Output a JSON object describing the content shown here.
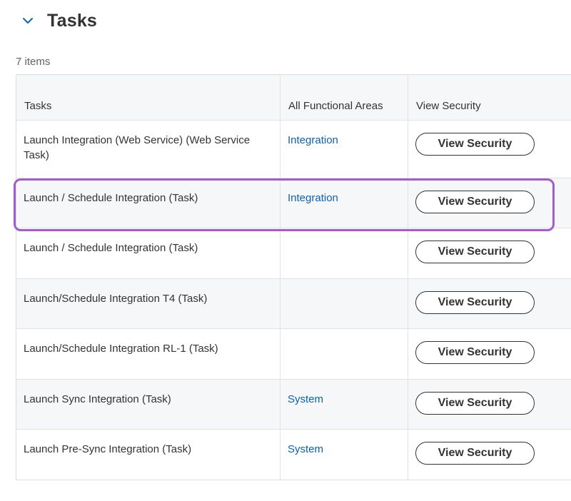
{
  "header": {
    "title": "Tasks",
    "toggle_icon": "chevron-down-icon",
    "accent_color": "#0b61b4"
  },
  "item_count": "7 items",
  "table": {
    "columns": [
      "Tasks",
      "All Functional Areas",
      "View Security"
    ],
    "rows": [
      {
        "task": "Launch Integration (Web Service) (Web Service Task)",
        "area": "Integration",
        "action": "View Security"
      },
      {
        "task": "Launch / Schedule Integration (Task)",
        "area": "Integration",
        "action": "View Security"
      },
      {
        "task": "Launch / Schedule Integration (Task)",
        "area": "",
        "action": "View Security"
      },
      {
        "task": "Launch/Schedule Integration T4 (Task)",
        "area": "",
        "action": "View Security"
      },
      {
        "task": "Launch/Schedule Integration RL-1 (Task)",
        "area": "",
        "action": "View Security"
      },
      {
        "task": "Launch Sync Integration (Task)",
        "area": "System",
        "action": "View Security"
      },
      {
        "task": "Launch Pre-Sync Integration (Task)",
        "area": "System",
        "action": "View Security"
      }
    ]
  },
  "highlight": {
    "row_index": 1,
    "color": "#a35dcc"
  }
}
